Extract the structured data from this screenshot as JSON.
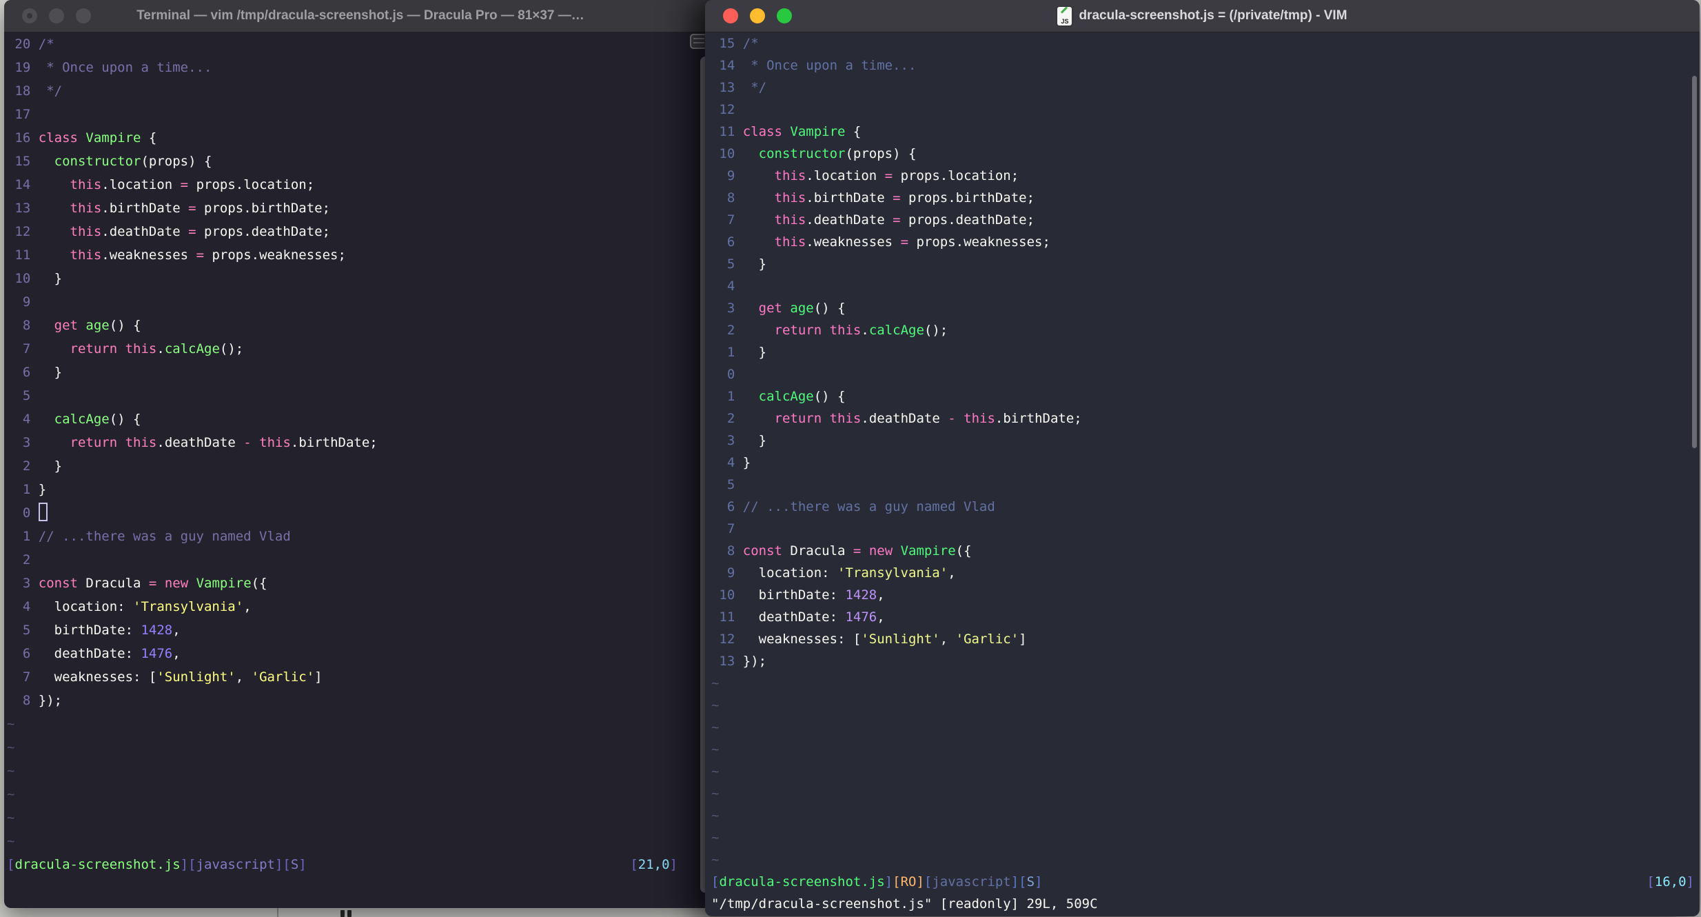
{
  "page": {
    "background_color": "#CFCFCB"
  },
  "left_window": {
    "title": "Terminal — vim /tmp/dracula-screenshot.js — Dracula Pro — 81×37 —…",
    "active": false,
    "theme": {
      "name": "Dracula Pro",
      "background": "#22212C",
      "foreground": "#F8F8F2",
      "comment": "#7970A9",
      "pink": "#FF80BF",
      "green": "#8AFF80",
      "yellow": "#FFFF80",
      "purple": "#9580FF",
      "cyan": "#80FFEA"
    },
    "tilde_count": 6,
    "lines": [
      {
        "n": "20",
        "segs": [
          [
            "com",
            "/*"
          ]
        ]
      },
      {
        "n": "19",
        "segs": [
          [
            "com",
            " * Once upon a time..."
          ]
        ]
      },
      {
        "n": "18",
        "segs": [
          [
            "com",
            " */"
          ]
        ]
      },
      {
        "n": "17",
        "segs": []
      },
      {
        "n": "16",
        "segs": [
          [
            "pink",
            "class"
          ],
          [
            "fg",
            " "
          ],
          [
            "green",
            "Vampire"
          ],
          [
            "fg",
            " {"
          ]
        ]
      },
      {
        "n": "15",
        "segs": [
          [
            "fg",
            "  "
          ],
          [
            "green",
            "constructor"
          ],
          [
            "fg",
            "(props) {"
          ]
        ]
      },
      {
        "n": "14",
        "segs": [
          [
            "fg",
            "    "
          ],
          [
            "pink",
            "this"
          ],
          [
            "fg",
            ".location "
          ],
          [
            "pink",
            "="
          ],
          [
            "fg",
            " props.location;"
          ]
        ]
      },
      {
        "n": "13",
        "segs": [
          [
            "fg",
            "    "
          ],
          [
            "pink",
            "this"
          ],
          [
            "fg",
            ".birthDate "
          ],
          [
            "pink",
            "="
          ],
          [
            "fg",
            " props.birthDate;"
          ]
        ]
      },
      {
        "n": "12",
        "segs": [
          [
            "fg",
            "    "
          ],
          [
            "pink",
            "this"
          ],
          [
            "fg",
            ".deathDate "
          ],
          [
            "pink",
            "="
          ],
          [
            "fg",
            " props.deathDate;"
          ]
        ]
      },
      {
        "n": "11",
        "segs": [
          [
            "fg",
            "    "
          ],
          [
            "pink",
            "this"
          ],
          [
            "fg",
            ".weaknesses "
          ],
          [
            "pink",
            "="
          ],
          [
            "fg",
            " props.weaknesses;"
          ]
        ]
      },
      {
        "n": "10",
        "segs": [
          [
            "fg",
            "  }"
          ]
        ]
      },
      {
        "n": "9",
        "segs": []
      },
      {
        "n": "8",
        "segs": [
          [
            "fg",
            "  "
          ],
          [
            "pink",
            "get"
          ],
          [
            "fg",
            " "
          ],
          [
            "green",
            "age"
          ],
          [
            "fg",
            "() {"
          ]
        ]
      },
      {
        "n": "7",
        "segs": [
          [
            "fg",
            "    "
          ],
          [
            "pink",
            "return"
          ],
          [
            "fg",
            " "
          ],
          [
            "pink",
            "this"
          ],
          [
            "fg",
            "."
          ],
          [
            "green",
            "calcAge"
          ],
          [
            "fg",
            "();"
          ]
        ]
      },
      {
        "n": "6",
        "segs": [
          [
            "fg",
            "  }"
          ]
        ]
      },
      {
        "n": "5",
        "segs": []
      },
      {
        "n": "4",
        "segs": [
          [
            "fg",
            "  "
          ],
          [
            "green",
            "calcAge"
          ],
          [
            "fg",
            "() {"
          ]
        ]
      },
      {
        "n": "3",
        "segs": [
          [
            "fg",
            "    "
          ],
          [
            "pink",
            "return"
          ],
          [
            "fg",
            " "
          ],
          [
            "pink",
            "this"
          ],
          [
            "fg",
            ".deathDate "
          ],
          [
            "pink",
            "-"
          ],
          [
            "fg",
            " "
          ],
          [
            "pink",
            "this"
          ],
          [
            "fg",
            ".birthDate;"
          ]
        ]
      },
      {
        "n": "2",
        "segs": [
          [
            "fg",
            "  }"
          ]
        ]
      },
      {
        "n": "1",
        "segs": [
          [
            "fg",
            "}"
          ]
        ]
      },
      {
        "n": "0",
        "segs": [],
        "cursor": true
      },
      {
        "n": "1",
        "segs": [
          [
            "com",
            "// ...there was a guy named Vlad"
          ]
        ]
      },
      {
        "n": "2",
        "segs": []
      },
      {
        "n": "3",
        "segs": [
          [
            "pink",
            "const"
          ],
          [
            "fg",
            " Dracula "
          ],
          [
            "pink",
            "="
          ],
          [
            "fg",
            " "
          ],
          [
            "pink",
            "new"
          ],
          [
            "fg",
            " "
          ],
          [
            "green",
            "Vampire"
          ],
          [
            "fg",
            "({"
          ]
        ]
      },
      {
        "n": "4",
        "segs": [
          [
            "fg",
            "  location: "
          ],
          [
            "yellow",
            "'Transylvania'"
          ],
          [
            "fg",
            ","
          ]
        ]
      },
      {
        "n": "5",
        "segs": [
          [
            "fg",
            "  birthDate: "
          ],
          [
            "num",
            "1428"
          ],
          [
            "fg",
            ","
          ]
        ]
      },
      {
        "n": "6",
        "segs": [
          [
            "fg",
            "  deathDate: "
          ],
          [
            "num",
            "1476"
          ],
          [
            "fg",
            ","
          ]
        ]
      },
      {
        "n": "7",
        "segs": [
          [
            "fg",
            "  weaknesses: ["
          ],
          [
            "yellow",
            "'Sunlight'"
          ],
          [
            "fg",
            ", "
          ],
          [
            "yellow",
            "'Garlic'"
          ],
          [
            "fg",
            "]"
          ]
        ]
      },
      {
        "n": "8",
        "segs": [
          [
            "fg",
            "});"
          ]
        ]
      }
    ],
    "statusline": {
      "segments": [
        [
          "sb",
          "["
        ],
        [
          "sf",
          "dracula-screenshot.js"
        ],
        [
          "sb",
          "]["
        ],
        [
          "sm",
          "javascript"
        ],
        [
          "sb",
          "]["
        ],
        [
          "ss",
          "S"
        ],
        [
          "sb",
          "]"
        ]
      ],
      "ruler": [
        [
          "rb",
          "["
        ],
        [
          "rn",
          "21,0"
        ],
        [
          "rb",
          "]"
        ]
      ]
    }
  },
  "right_window": {
    "title": "dracula-screenshot.js = (/private/tmp) - VIM",
    "active": true,
    "doc_icon_label": "JS",
    "theme": {
      "name": "Dracula",
      "background": "#282A36",
      "foreground": "#F8F8F2",
      "comment": "#6272A4",
      "pink": "#FF79C6",
      "green": "#50FA7B",
      "yellow": "#F1FA8C",
      "purple": "#BD93F9",
      "cyan": "#8BE9FD",
      "orange": "#FFB86C"
    },
    "tilde_count": 9,
    "lines": [
      {
        "n": "15",
        "segs": [
          [
            "com",
            "/*"
          ]
        ]
      },
      {
        "n": "14",
        "segs": [
          [
            "com",
            " * Once upon a time..."
          ]
        ]
      },
      {
        "n": "13",
        "segs": [
          [
            "com",
            " */"
          ]
        ]
      },
      {
        "n": "12",
        "segs": []
      },
      {
        "n": "11",
        "segs": [
          [
            "pink",
            "class"
          ],
          [
            "fg",
            " "
          ],
          [
            "green",
            "Vampire"
          ],
          [
            "fg",
            " {"
          ]
        ]
      },
      {
        "n": "10",
        "segs": [
          [
            "fg",
            "  "
          ],
          [
            "green",
            "constructor"
          ],
          [
            "fg",
            "(props) {"
          ]
        ]
      },
      {
        "n": "9",
        "segs": [
          [
            "fg",
            "    "
          ],
          [
            "pink",
            "this"
          ],
          [
            "fg",
            ".location "
          ],
          [
            "pink",
            "="
          ],
          [
            "fg",
            " props.location;"
          ]
        ]
      },
      {
        "n": "8",
        "segs": [
          [
            "fg",
            "    "
          ],
          [
            "pink",
            "this"
          ],
          [
            "fg",
            ".birthDate "
          ],
          [
            "pink",
            "="
          ],
          [
            "fg",
            " props.birthDate;"
          ]
        ]
      },
      {
        "n": "7",
        "segs": [
          [
            "fg",
            "    "
          ],
          [
            "pink",
            "this"
          ],
          [
            "fg",
            ".deathDate "
          ],
          [
            "pink",
            "="
          ],
          [
            "fg",
            " props.deathDate;"
          ]
        ]
      },
      {
        "n": "6",
        "segs": [
          [
            "fg",
            "    "
          ],
          [
            "pink",
            "this"
          ],
          [
            "fg",
            ".weaknesses "
          ],
          [
            "pink",
            "="
          ],
          [
            "fg",
            " props.weaknesses;"
          ]
        ]
      },
      {
        "n": "5",
        "segs": [
          [
            "fg",
            "  }"
          ]
        ]
      },
      {
        "n": "4",
        "segs": []
      },
      {
        "n": "3",
        "segs": [
          [
            "fg",
            "  "
          ],
          [
            "pink",
            "get"
          ],
          [
            "fg",
            " "
          ],
          [
            "green",
            "age"
          ],
          [
            "fg",
            "() {"
          ]
        ]
      },
      {
        "n": "2",
        "segs": [
          [
            "fg",
            "    "
          ],
          [
            "pink",
            "return"
          ],
          [
            "fg",
            " "
          ],
          [
            "pink",
            "this"
          ],
          [
            "fg",
            "."
          ],
          [
            "green",
            "calcAge"
          ],
          [
            "fg",
            "();"
          ]
        ]
      },
      {
        "n": "1",
        "segs": [
          [
            "fg",
            "  }"
          ]
        ]
      },
      {
        "n": "0",
        "segs": []
      },
      {
        "n": "1",
        "segs": [
          [
            "fg",
            "  "
          ],
          [
            "green",
            "calcAge"
          ],
          [
            "fg",
            "() {"
          ]
        ]
      },
      {
        "n": "2",
        "segs": [
          [
            "fg",
            "    "
          ],
          [
            "pink",
            "return"
          ],
          [
            "fg",
            " "
          ],
          [
            "pink",
            "this"
          ],
          [
            "fg",
            ".deathDate "
          ],
          [
            "pink",
            "-"
          ],
          [
            "fg",
            " "
          ],
          [
            "pink",
            "this"
          ],
          [
            "fg",
            ".birthDate;"
          ]
        ]
      },
      {
        "n": "3",
        "segs": [
          [
            "fg",
            "  }"
          ]
        ]
      },
      {
        "n": "4",
        "segs": [
          [
            "fg",
            "}"
          ]
        ]
      },
      {
        "n": "5",
        "segs": []
      },
      {
        "n": "6",
        "segs": [
          [
            "com",
            "// ...there was a guy named Vlad"
          ]
        ]
      },
      {
        "n": "7",
        "segs": []
      },
      {
        "n": "8",
        "segs": [
          [
            "pink",
            "const"
          ],
          [
            "fg",
            " Dracula "
          ],
          [
            "pink",
            "="
          ],
          [
            "fg",
            " "
          ],
          [
            "pink",
            "new"
          ],
          [
            "fg",
            " "
          ],
          [
            "green",
            "Vampire"
          ],
          [
            "fg",
            "({"
          ]
        ]
      },
      {
        "n": "9",
        "segs": [
          [
            "fg",
            "  location: "
          ],
          [
            "yellow",
            "'Transylvania'"
          ],
          [
            "fg",
            ","
          ]
        ]
      },
      {
        "n": "10",
        "segs": [
          [
            "fg",
            "  birthDate: "
          ],
          [
            "num",
            "1428"
          ],
          [
            "fg",
            ","
          ]
        ]
      },
      {
        "n": "11",
        "segs": [
          [
            "fg",
            "  deathDate: "
          ],
          [
            "num",
            "1476"
          ],
          [
            "fg",
            ","
          ]
        ]
      },
      {
        "n": "12",
        "segs": [
          [
            "fg",
            "  weaknesses: ["
          ],
          [
            "yellow",
            "'Sunlight'"
          ],
          [
            "fg",
            ", "
          ],
          [
            "yellow",
            "'Garlic'"
          ],
          [
            "fg",
            "]"
          ]
        ]
      },
      {
        "n": "13",
        "segs": [
          [
            "fg",
            "});"
          ]
        ]
      }
    ],
    "statusline": {
      "segments": [
        [
          "sb",
          "["
        ],
        [
          "sf",
          "dracula-screenshot.js"
        ],
        [
          "sb",
          "]"
        ],
        [
          "so",
          "[RO]"
        ],
        [
          "sb",
          "["
        ],
        [
          "sm",
          "javascript"
        ],
        [
          "sb",
          "]["
        ],
        [
          "ss",
          "S"
        ],
        [
          "sb",
          "]"
        ]
      ],
      "ruler": [
        [
          "rb",
          "["
        ],
        [
          "rn",
          "16,0"
        ],
        [
          "rb",
          "]"
        ]
      ]
    },
    "message_line": "\"/tmp/dracula-screenshot.js\" [readonly] 29L, 509C"
  }
}
